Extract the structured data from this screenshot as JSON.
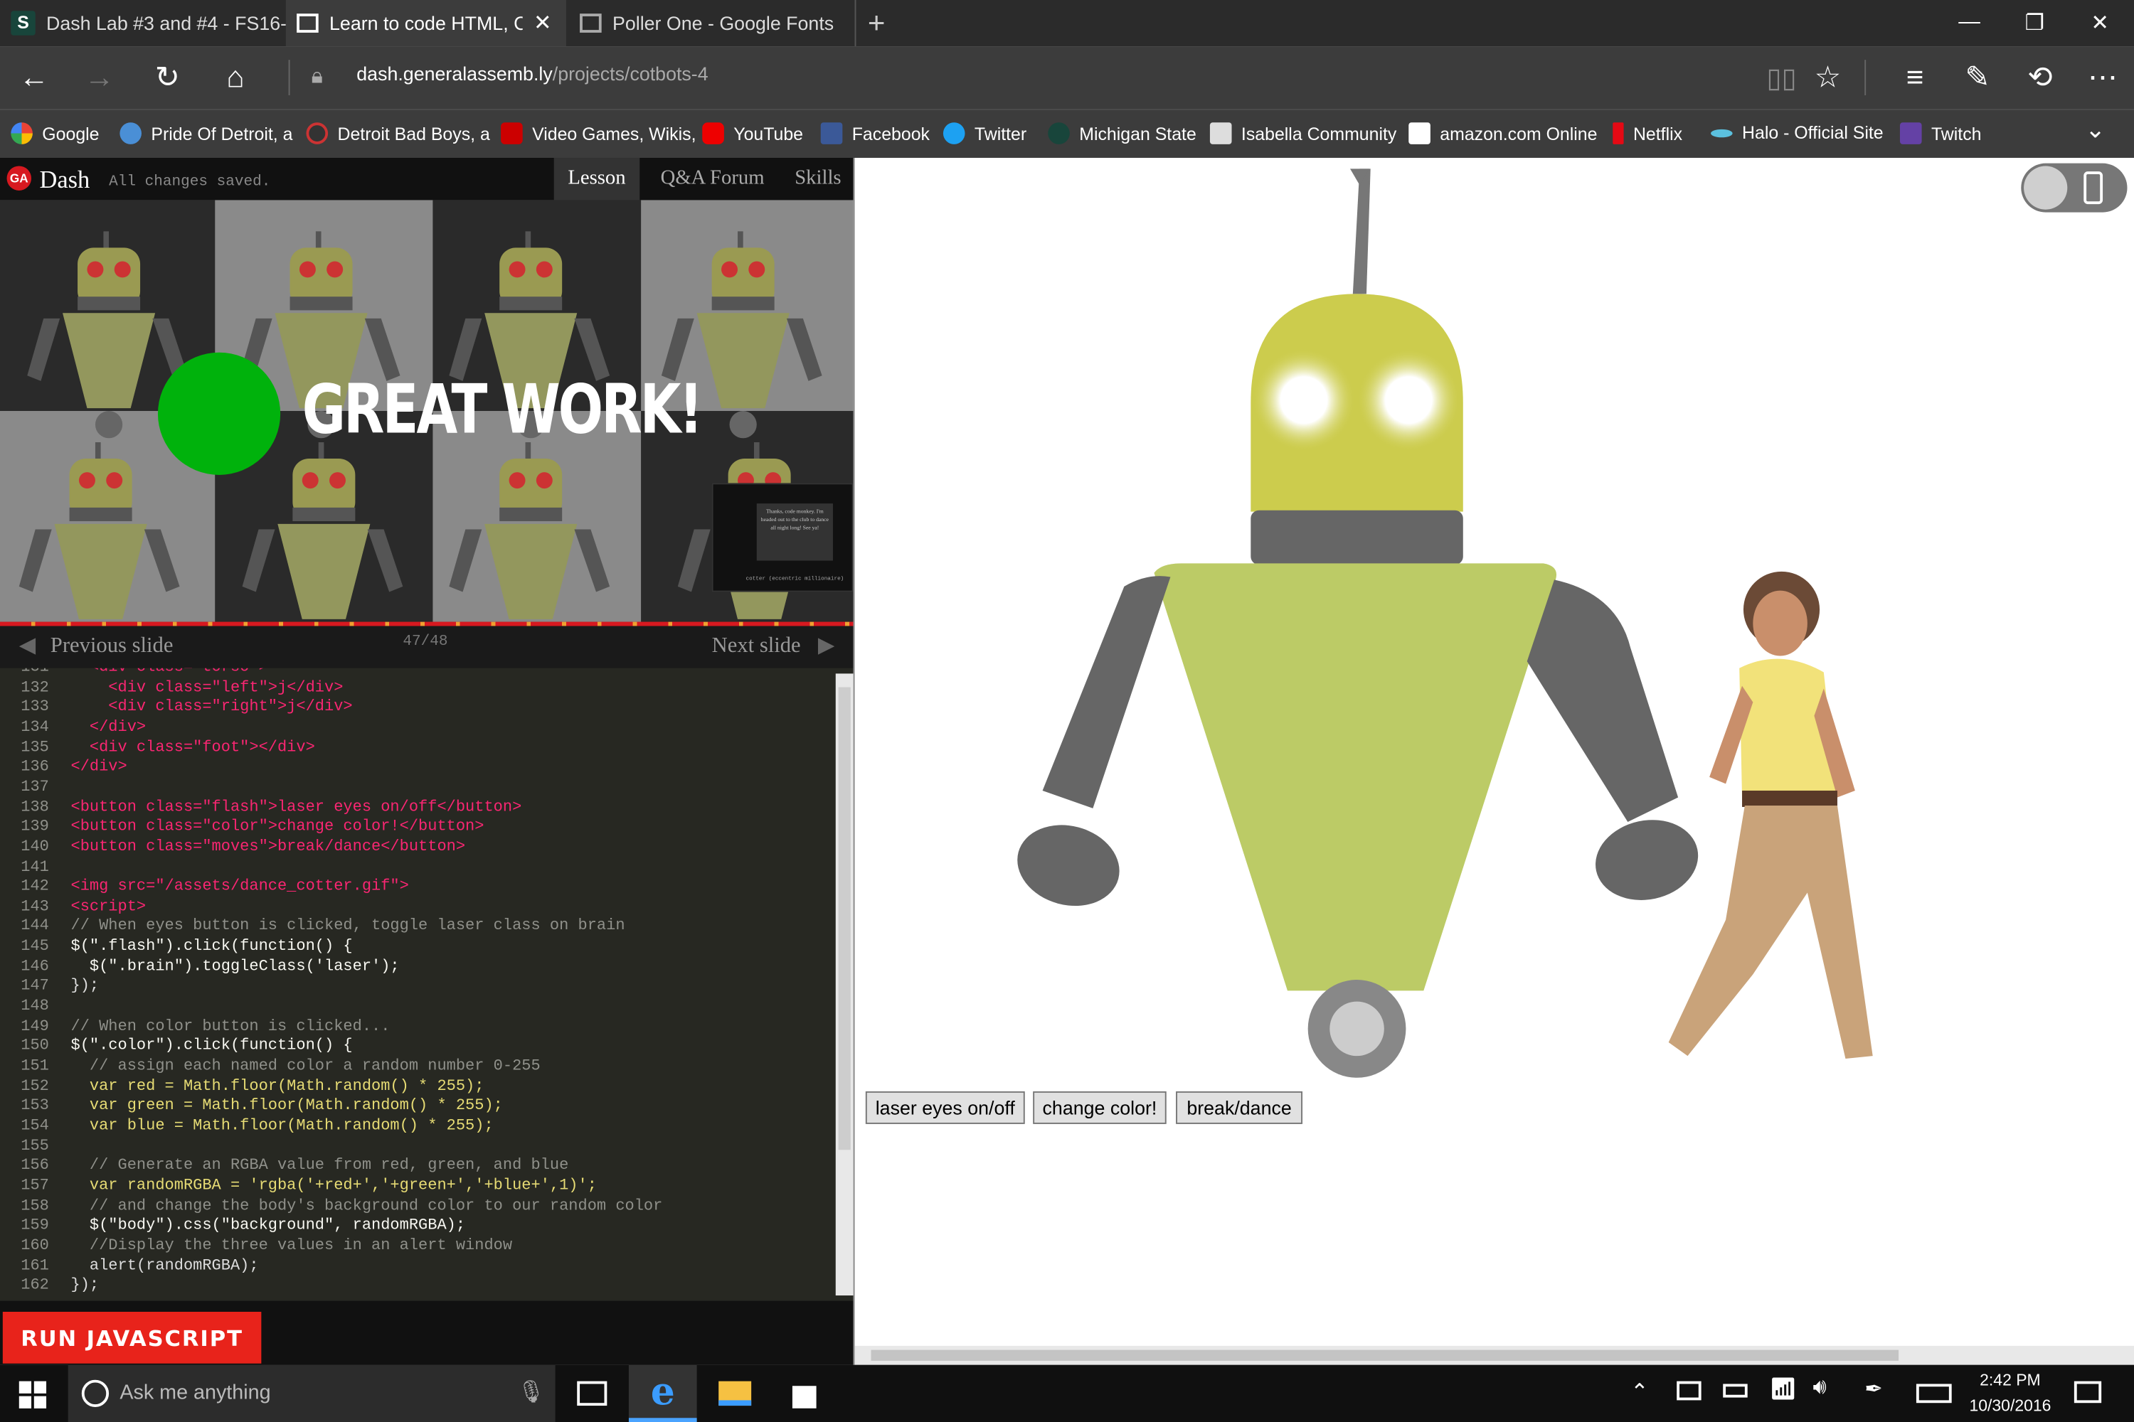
{
  "browser": {
    "tabs": [
      {
        "label": "Dash Lab #3 and #4 - FS16-",
        "active": false
      },
      {
        "label": "Learn to code HTML, CS",
        "active": true
      },
      {
        "label": "Poller One - Google Fonts",
        "active": false
      }
    ],
    "url_domain": "dash.generalassemb.ly",
    "url_path": "/projects/cotbots-4",
    "favorites": [
      "Google",
      "Pride Of Detroit, a",
      "Detroit Bad Boys, a",
      "Video Games, Wikis,",
      "YouTube",
      "Facebook",
      "Twitter",
      "Michigan State",
      "Isabella Community",
      "amazon.com Online",
      "Netflix",
      "Halo - Official Site",
      "Twitch"
    ]
  },
  "dash": {
    "logo": "Dash",
    "status": "All changes saved.",
    "tabs": [
      "Lesson",
      "Q&A Forum",
      "Skills"
    ],
    "slide_headline": "GREAT WORK!",
    "prev_label": "Previous slide",
    "next_label": "Next slide",
    "slide_counter": "47/48",
    "note_text": "Thanks, code monkey. I'm headed out to the club to dance all night long! See ya!",
    "note_caption": "cotter (eccentric millionaire)",
    "run_label": "RUN JAVASCRIPT"
  },
  "code_lines": [
    {
      "n": "131",
      "t": "  <div class=\"torso\">"
    },
    {
      "n": "132",
      "t": "    <div class=\"left\">j</div>"
    },
    {
      "n": "133",
      "t": "    <div class=\"right\">j</div>"
    },
    {
      "n": "134",
      "t": "  </div>"
    },
    {
      "n": "135",
      "t": "  <div class=\"foot\"></div>"
    },
    {
      "n": "136",
      "t": "</div>"
    },
    {
      "n": "137",
      "t": ""
    },
    {
      "n": "138",
      "t": "<button class=\"flash\">laser eyes on/off</button>"
    },
    {
      "n": "139",
      "t": "<button class=\"color\">change color!</button>"
    },
    {
      "n": "140",
      "t": "<button class=\"moves\">break/dance</button>"
    },
    {
      "n": "141",
      "t": ""
    },
    {
      "n": "142",
      "t": "<img src=\"/assets/dance_cotter.gif\">"
    },
    {
      "n": "143",
      "t": "<script>"
    },
    {
      "n": "144",
      "t": "// When eyes button is clicked, toggle laser class on brain"
    },
    {
      "n": "145",
      "t": "$(\".flash\").click(function() {"
    },
    {
      "n": "146",
      "t": "  $(\".brain\").toggleClass('laser');"
    },
    {
      "n": "147",
      "t": "});"
    },
    {
      "n": "148",
      "t": ""
    },
    {
      "n": "149",
      "t": "// When color button is clicked..."
    },
    {
      "n": "150",
      "t": "$(\".color\").click(function() {"
    },
    {
      "n": "151",
      "t": "  // assign each named color a random number 0-255"
    },
    {
      "n": "152",
      "t": "  var red = Math.floor(Math.random() * 255);"
    },
    {
      "n": "153",
      "t": "  var green = Math.floor(Math.random() * 255);"
    },
    {
      "n": "154",
      "t": "  var blue = Math.floor(Math.random() * 255);"
    },
    {
      "n": "155",
      "t": ""
    },
    {
      "n": "156",
      "t": "  // Generate an RGBA value from red, green, and blue"
    },
    {
      "n": "157",
      "t": "  var randomRGBA = 'rgba('+red+','+green+','+blue+',1)';"
    },
    {
      "n": "158",
      "t": "  // and change the body's background color to our random color"
    },
    {
      "n": "159",
      "t": "  $(\"body\").css(\"background\", randomRGBA);"
    },
    {
      "n": "160",
      "t": "  //Display the three values in an alert window"
    },
    {
      "n": "161",
      "t": "  alert(randomRGBA);"
    },
    {
      "n": "162",
      "t": "});"
    }
  ],
  "preview": {
    "buttons": [
      "laser eyes on/off",
      "change color!",
      "break/dance"
    ]
  },
  "taskbar": {
    "search_placeholder": "Ask me anything",
    "time": "2:42 PM",
    "date": "10/30/2016"
  },
  "colors": {
    "robot_head": "#cccc4d",
    "robot_torso": "#bccb66",
    "robot_gray": "#666666",
    "run_button": "#e8231b",
    "dash_red": "#d71920"
  }
}
